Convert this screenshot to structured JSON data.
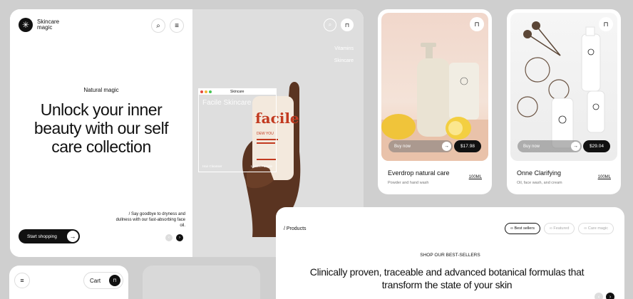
{
  "hero": {
    "logo_text": "Skincare magic",
    "eyebrow": "Natural magic",
    "headline": "Unlock your inner beauty with our self care collection",
    "sub_copy": "/ Say goodbye to dryness and dullness with our fast-absorbing face oil.",
    "cta_label": "Start shopping",
    "menu_items": [
      "Vitamins",
      "Skincare"
    ],
    "window_title": "Skincare",
    "window_brand": "Facile Skincare",
    "window_foot_left": "Hair Cleanser",
    "window_foot_right": "Unisex Female"
  },
  "products": [
    {
      "name": "Everdrop natural care",
      "desc": "Powder and hand wash",
      "size": "100ML",
      "buy_label": "Buy now",
      "price": "$17.98"
    },
    {
      "name": "Onne Clarifying",
      "desc": "Oil, face wash, and cream",
      "size": "100ML",
      "buy_label": "Buy now",
      "price": "$29.04"
    }
  ],
  "catalog": {
    "crumb": "/ Products",
    "chips": [
      "Best sellers",
      "Featured",
      "Care magic"
    ],
    "kicker": "SHOP OUR BEST-SELLERS",
    "statement": "Clinically proven, traceable and advanced botanical formulas that transform the state of your skin"
  },
  "mini_header": {
    "cart_label": "Cart"
  },
  "colors": {
    "accent": "#111111",
    "panel": "#dedede",
    "peach": "#f1d7cb",
    "hero_red": "#c23a20"
  },
  "icons": [
    "search-icon",
    "menu-icon",
    "bag-icon",
    "arrow-right-icon",
    "arrow-left-icon"
  ]
}
